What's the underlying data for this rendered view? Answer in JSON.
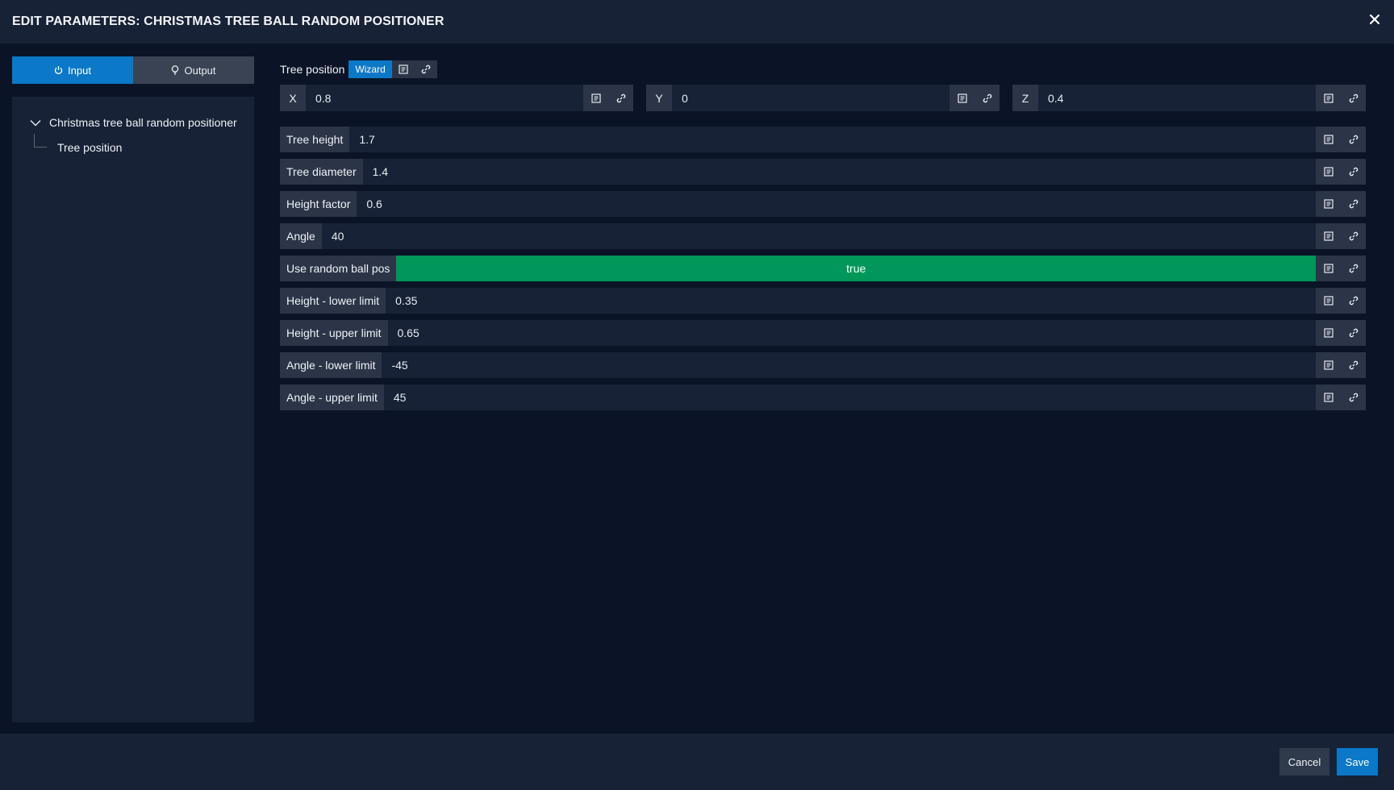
{
  "header": {
    "title": "EDIT PARAMETERS: CHRISTMAS TREE BALL RANDOM POSITIONER",
    "close_icon": "close-icon"
  },
  "tabs": [
    {
      "label": "Input",
      "icon": "power-icon",
      "active": true
    },
    {
      "label": "Output",
      "icon": "lightbulb-icon",
      "active": false
    }
  ],
  "tree": {
    "root_label": "Christmas tree ball random positioner",
    "child_label": "Tree position"
  },
  "tree_position": {
    "label": "Tree position",
    "wizard_label": "Wizard",
    "x": {
      "label": "X",
      "value": "0.8"
    },
    "y": {
      "label": "Y",
      "value": "0"
    },
    "z": {
      "label": "Z",
      "value": "0.4"
    }
  },
  "params": [
    {
      "label": "Tree height",
      "value": "1.7"
    },
    {
      "label": "Tree diameter",
      "value": "1.4"
    },
    {
      "label": "Height factor",
      "value": "0.6"
    },
    {
      "label": "Angle",
      "value": "40"
    },
    {
      "label": "Use random ball pos",
      "value": "true"
    },
    {
      "label": "Height - lower limit",
      "value": "0.35"
    },
    {
      "label": "Height - upper limit",
      "value": "0.65"
    },
    {
      "label": "Angle - lower limit",
      "value": "-45"
    },
    {
      "label": "Angle - upper limit",
      "value": "45"
    }
  ],
  "footer": {
    "cancel_label": "Cancel",
    "save_label": "Save"
  },
  "colors": {
    "accent": "#0b78c8",
    "true_green": "#01975a",
    "panel": "#172236",
    "background": "#0b1427"
  }
}
